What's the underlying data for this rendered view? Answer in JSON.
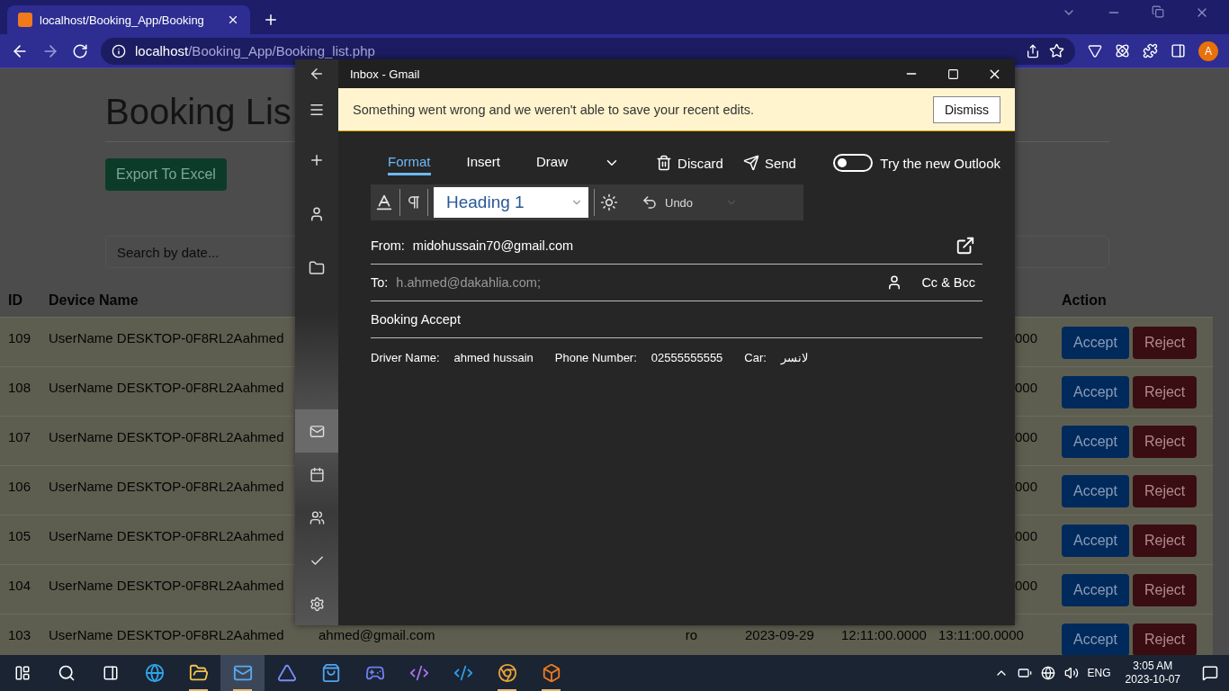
{
  "browser": {
    "tab_title": "localhost/Booking_App/Booking",
    "address_host": "localhost",
    "address_path": "/Booking_App/Booking_list.php",
    "avatar": "A"
  },
  "page": {
    "title": "Booking Lis",
    "export_button": "Export To Excel",
    "search_placeholder": "Search by date...",
    "columns": [
      "ID",
      "Device Name",
      "Action"
    ],
    "rows": [
      {
        "id": "109",
        "device": "UserName DESKTOP-0F8RL2Aahmed",
        "end": "000",
        "accept": "Accept",
        "reject": "Reject"
      },
      {
        "id": "108",
        "device": "UserName DESKTOP-0F8RL2Aahmed",
        "end": "000",
        "accept": "Accept",
        "reject": "Reject"
      },
      {
        "id": "107",
        "device": "UserName DESKTOP-0F8RL2Aahmed",
        "end": "000",
        "accept": "Accept",
        "reject": "Reject"
      },
      {
        "id": "106",
        "device": "UserName DESKTOP-0F8RL2Aahmed",
        "end": "000",
        "accept": "Accept",
        "reject": "Reject"
      },
      {
        "id": "105",
        "device": "UserName DESKTOP-0F8RL2Aahmed",
        "end": "000",
        "accept": "Accept",
        "reject": "Reject"
      },
      {
        "id": "104",
        "device": "UserName DESKTOP-0F8RL2Aahmed",
        "end": "000",
        "accept": "Accept",
        "reject": "Reject"
      },
      {
        "id": "103",
        "device": "UserName DESKTOP-0F8RL2Aahmed",
        "email": "ahmed@gmail.com",
        "column_4": "ro",
        "date": "2023-09-29",
        "start": "12:11:00.0000",
        "end": "13:11:00.0000",
        "accept": "Accept",
        "reject": "Reject"
      }
    ]
  },
  "mail": {
    "title": "Inbox - Gmail",
    "sidebar": [
      {
        "kind": "mail",
        "selected": true
      },
      {
        "kind": "calendar",
        "selected": false
      },
      {
        "kind": "people",
        "selected": false
      },
      {
        "kind": "todo",
        "selected": false
      },
      {
        "kind": "settings",
        "selected": false
      }
    ],
    "banner": {
      "message": "Something went wrong and we weren't able to save your recent edits.",
      "button": "Dismiss"
    },
    "tabs": [
      {
        "label": "Format",
        "selected": true
      },
      {
        "label": "Insert",
        "selected": false
      },
      {
        "label": "Draw",
        "selected": false
      }
    ],
    "discard": "Discard",
    "send": "Send",
    "toggle": {
      "label": "Try the new Outlook",
      "on": false
    },
    "style": "Heading 1",
    "undo": "Undo",
    "from_label": "From:",
    "from": "midohussain70@gmail.com",
    "to_label": "To:",
    "to": "h.ahmed@dakahlia.com;",
    "cc": "Cc & Bcc",
    "subject": "Booking Accept",
    "body": [
      {
        "label": "Driver Name:",
        "value": "ahmed hussain"
      },
      {
        "label": "Phone Number:",
        "value": "02555555555"
      },
      {
        "label": "Car:",
        "value": "لانسر"
      }
    ]
  },
  "taskbar": {
    "apps": [
      {
        "kind": "edge",
        "selected": false,
        "open": false
      },
      {
        "kind": "explorer",
        "selected": false,
        "open": true
      },
      {
        "kind": "mail",
        "selected": true,
        "open": true
      },
      {
        "kind": "copilot",
        "selected": false,
        "open": false
      },
      {
        "kind": "store",
        "selected": false,
        "open": false
      },
      {
        "kind": "discord",
        "selected": false,
        "open": false
      },
      {
        "kind": "vs",
        "selected": false,
        "open": false
      },
      {
        "kind": "vscode",
        "selected": false,
        "open": false
      },
      {
        "kind": "chrome",
        "selected": false,
        "open": true
      },
      {
        "kind": "xampp",
        "selected": false,
        "open": true
      }
    ],
    "lang": "ENG",
    "time": "3:05 AM",
    "date": "2023-10-07"
  }
}
